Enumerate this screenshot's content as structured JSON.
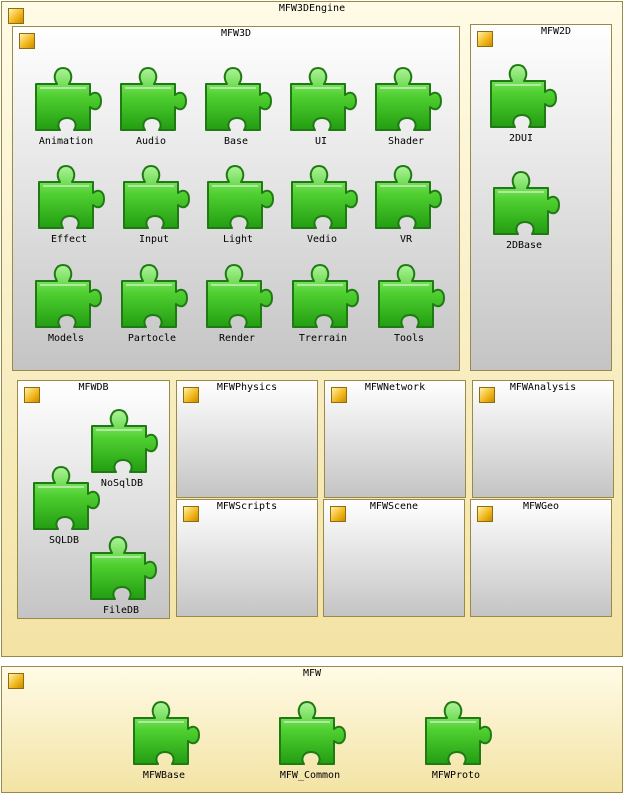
{
  "engine": {
    "title": "MFW3DEngine"
  },
  "mfw3d": {
    "title": "MFW3D",
    "components": [
      "Animation",
      "Audio",
      "Base",
      "UI",
      "Shader",
      "Effect",
      "Input",
      "Light",
      "Vedio",
      "VR",
      "Models",
      "Partocle",
      "Render",
      "Trerrain",
      "Tools"
    ]
  },
  "mfw2d": {
    "title": "MFW2D",
    "components": [
      "2DUI",
      "2DBase"
    ]
  },
  "mfwdb": {
    "title": "MFWDB",
    "components": [
      "NoSqlDB",
      "SQLDB",
      "FileDB"
    ]
  },
  "empty_packages": [
    "MFWPhysics",
    "MFWNetwork",
    "MFWAnalysis",
    "MFWScripts",
    "MFWScene",
    "MFWGeo"
  ],
  "mfw": {
    "title": "MFW",
    "components": [
      "MFWBase",
      "MFW_Common",
      "MFWProto"
    ]
  },
  "colors": {
    "component_green": "#3fbf2a",
    "component_outline": "#1f7a14",
    "package_icon": "#f0b418",
    "border": "#9a8a4a"
  }
}
